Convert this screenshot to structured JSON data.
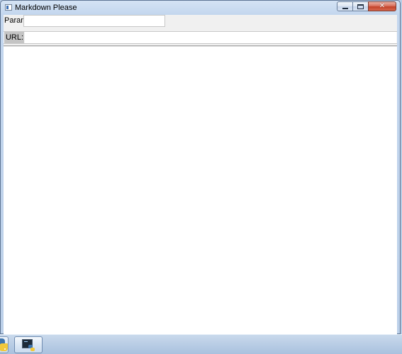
{
  "window": {
    "title": "Markdown Please",
    "controls": {
      "minimize_icon": "minimize-icon",
      "maximize_icon": "maximize-icon",
      "close_icon": "close-icon",
      "close_glyph": "✕"
    }
  },
  "form": {
    "param_label": "Param:",
    "param_value": "",
    "url_label": "URL:",
    "url_value": ""
  },
  "content": {
    "text": ""
  },
  "taskbar": {
    "items": [
      {
        "icon": "python-icon",
        "state": "inactive"
      },
      {
        "icon": "python-terminal-icon",
        "state": "active"
      }
    ]
  },
  "colors": {
    "frame": "#bcd0e9",
    "client_bg": "#f0f0f0",
    "content_bg": "#ffffff",
    "close_button": "#c2432a",
    "taskbar": "#b9cde6"
  }
}
